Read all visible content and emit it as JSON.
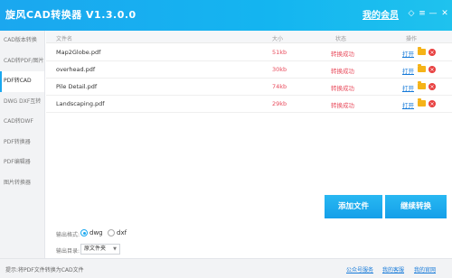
{
  "app": {
    "title": "旋风CAD转换器 V1.3.0.0",
    "vip_link": "我的会员"
  },
  "window_controls": [
    {
      "name": "skin-icon",
      "glyph": "◇"
    },
    {
      "name": "menu-icon",
      "glyph": "≡"
    },
    {
      "name": "minimize-icon",
      "glyph": "—"
    },
    {
      "name": "close-icon",
      "glyph": "✕"
    }
  ],
  "sidebar": {
    "items": [
      {
        "label": "CAD版本转换"
      },
      {
        "label": "CAD转PDF/图片"
      },
      {
        "label": "PDF转CAD"
      },
      {
        "label": "DWG DXF互转"
      },
      {
        "label": "CAD转DWF"
      },
      {
        "label": "PDF转换器"
      },
      {
        "label": "PDF编辑器"
      },
      {
        "label": "图片转换器"
      }
    ],
    "active_index": 2
  },
  "table": {
    "headers": {
      "name": "文件名",
      "size": "大小",
      "status": "状态",
      "action": "操作"
    },
    "rows": [
      {
        "name": "Map2Globe.pdf",
        "size": "51kb",
        "status": "转换成功",
        "open": "打开"
      },
      {
        "name": "overhead.pdf",
        "size": "30kb",
        "status": "转换成功",
        "open": "打开"
      },
      {
        "name": "Pile Detail.pdf",
        "size": "74kb",
        "status": "转换成功",
        "open": "打开"
      },
      {
        "name": "Landscaping.pdf",
        "size": "29kb",
        "status": "转换成功",
        "open": "打开"
      }
    ]
  },
  "buttons": {
    "add_file": "添加文件",
    "continue_convert": "继续转换"
  },
  "options": {
    "format_label": "输出格式:",
    "formats": [
      "dwg",
      "dxf"
    ],
    "selected_format": "dwg",
    "dir_label": "输出目录:",
    "dir_value": "原文件夹"
  },
  "status_bar": {
    "text": "提示:将PDF文件转换为CAD文件",
    "links": [
      "公众号服务",
      "我的客服",
      "我的官网"
    ]
  },
  "colors": {
    "accent": "#1aa8ef",
    "status_success": "#e84b5c",
    "link": "#1479d9"
  }
}
